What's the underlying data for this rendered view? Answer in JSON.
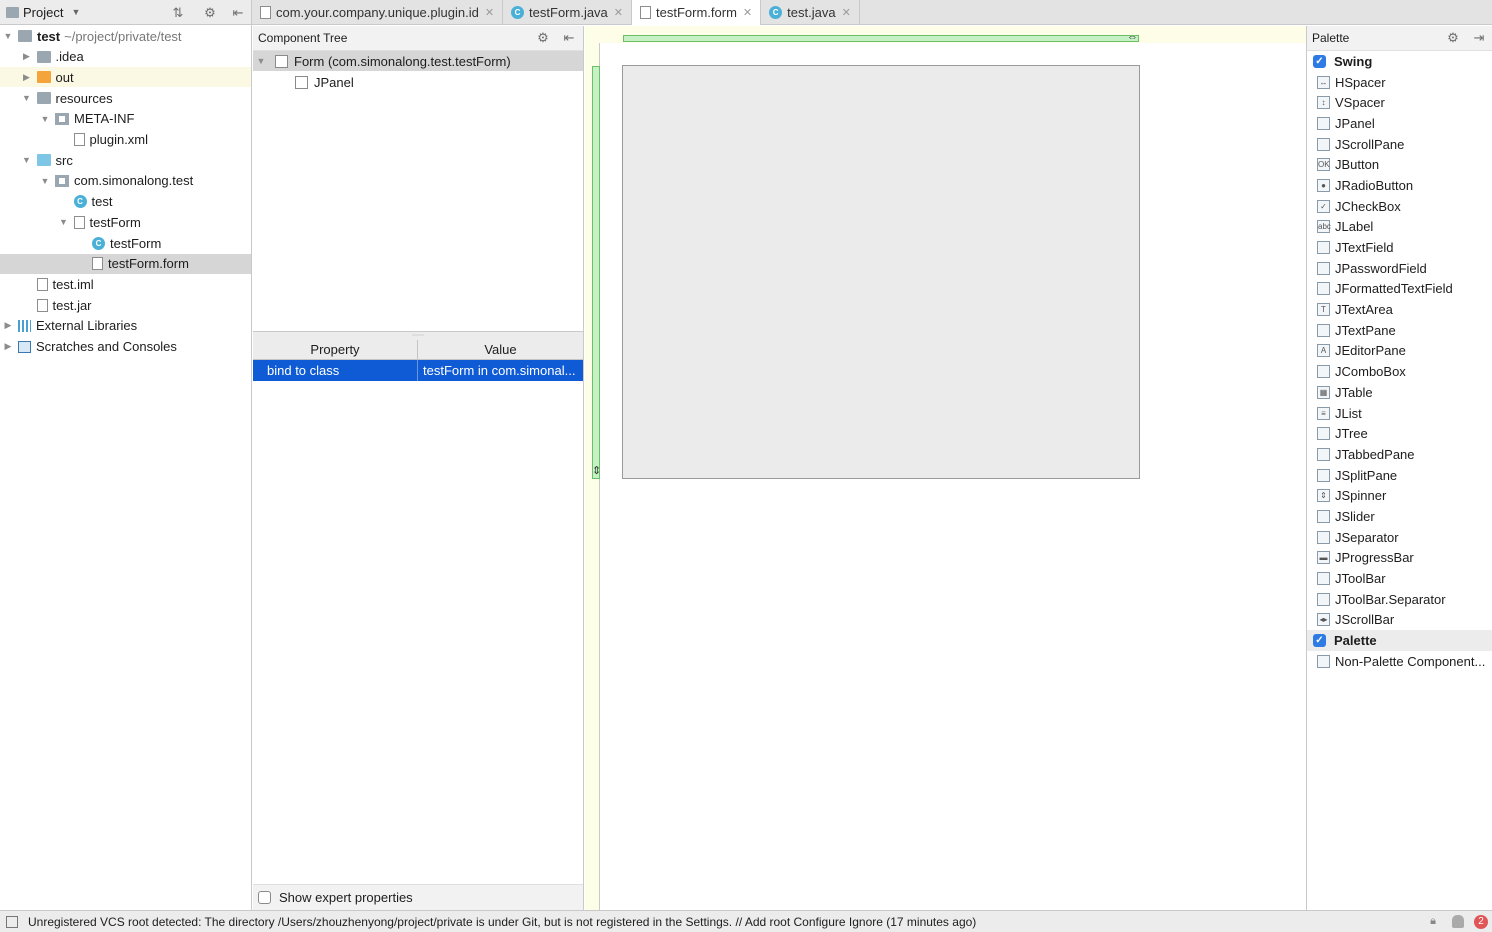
{
  "project": {
    "title": "Project",
    "tree": [
      {
        "label": "test",
        "suffix": "~/project/private/test",
        "indent": 0,
        "arrow": "▼",
        "icon": "module-folder",
        "bold": true
      },
      {
        "label": ".idea",
        "indent": 1,
        "arrow": "▶",
        "icon": "folder"
      },
      {
        "label": "out",
        "indent": 1,
        "arrow": "▶",
        "icon": "folder-orange",
        "highlight": true
      },
      {
        "label": "resources",
        "indent": 1,
        "arrow": "▼",
        "icon": "resources-folder"
      },
      {
        "label": "META-INF",
        "indent": 2,
        "arrow": "▼",
        "icon": "package"
      },
      {
        "label": "plugin.xml",
        "indent": 3,
        "arrow": "",
        "icon": "xml-file"
      },
      {
        "label": "src",
        "indent": 1,
        "arrow": "▼",
        "icon": "folder-blue"
      },
      {
        "label": "com.simonalong.test",
        "indent": 2,
        "arrow": "▼",
        "icon": "package"
      },
      {
        "label": "test",
        "indent": 3,
        "arrow": "",
        "icon": "class"
      },
      {
        "label": "testForm",
        "indent": 3,
        "arrow": "▼",
        "icon": "form-file"
      },
      {
        "label": "testForm",
        "indent": 4,
        "arrow": "",
        "icon": "class"
      },
      {
        "label": "testForm.form",
        "indent": 4,
        "arrow": "",
        "icon": "form-file",
        "selected": true
      },
      {
        "label": "test.iml",
        "indent": 1,
        "arrow": "",
        "icon": "iml-file"
      },
      {
        "label": "test.jar",
        "indent": 1,
        "arrow": "",
        "icon": "jar-file"
      },
      {
        "label": "External Libraries",
        "indent": 0,
        "arrow": "▶",
        "icon": "libraries"
      },
      {
        "label": "Scratches and Consoles",
        "indent": 0,
        "arrow": "▶",
        "icon": "scratches"
      }
    ]
  },
  "tabs": [
    {
      "label": "com.your.company.unique.plugin.id",
      "icon": "xml-file",
      "active": false
    },
    {
      "label": "testForm.java",
      "icon": "class",
      "active": false
    },
    {
      "label": "testForm.form",
      "icon": "form-file",
      "active": true
    },
    {
      "label": "test.java",
      "icon": "class",
      "active": false
    }
  ],
  "component_tree": {
    "title": "Component Tree",
    "items": [
      {
        "label": "Form (com.simonalong.test.testForm)",
        "indent": 0,
        "arrow": "▼",
        "selected": true
      },
      {
        "label": "JPanel",
        "indent": 1,
        "arrow": "",
        "selected": false
      }
    ]
  },
  "properties": {
    "columns": [
      "Property",
      "Value"
    ],
    "rows": [
      {
        "property": "bind to class",
        "value": "testForm in com.simonal..."
      }
    ],
    "expert_label": "Show expert properties"
  },
  "palette": {
    "title": "Palette",
    "groups": [
      {
        "name": "Swing",
        "items": [
          "HSpacer",
          "VSpacer",
          "JPanel",
          "JScrollPane",
          "JButton",
          "JRadioButton",
          "JCheckBox",
          "JLabel",
          "JTextField",
          "JPasswordField",
          "JFormattedTextField",
          "JTextArea",
          "JTextPane",
          "JEditorPane",
          "JComboBox",
          "JTable",
          "JList",
          "JTree",
          "JTabbedPane",
          "JSplitPane",
          "JSpinner",
          "JSlider",
          "JSeparator",
          "JProgressBar",
          "JToolBar",
          "JToolBar.Separator",
          "JScrollBar"
        ]
      },
      {
        "name": "Palette",
        "items": [
          "Non-Palette Component..."
        ]
      }
    ]
  },
  "status_bar": {
    "message": "Unregistered VCS root detected: The directory /Users/zhouzhenyong/project/private is under Git, but is not registered in the Settings. // Add root  Configure  Ignore (17 minutes ago)",
    "notification_count": "2"
  },
  "colors": {
    "selection_blue": "#0f5bd6",
    "guide_green": "#c6f1c4",
    "designer_bg": "#fefde7"
  }
}
